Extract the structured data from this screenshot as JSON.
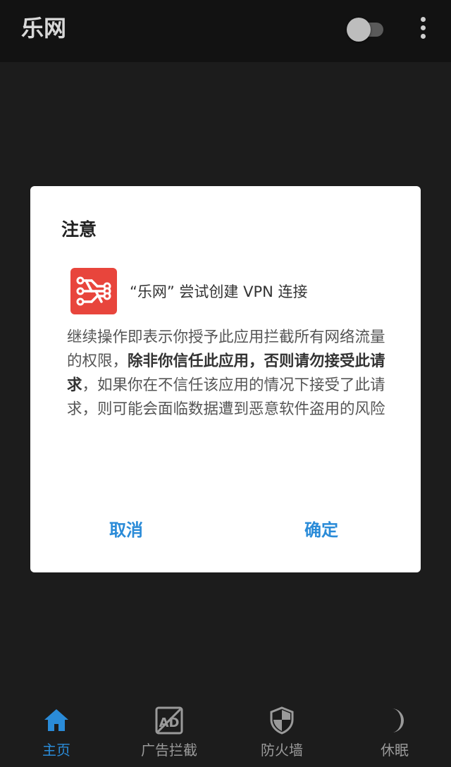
{
  "appbar": {
    "title": "乐网",
    "toggle_state": "off"
  },
  "dialog": {
    "title": "注意",
    "vpn_request": "“乐网” 尝试创建 VPN 连接",
    "body": {
      "part1": "继续操作即表示你授予此应用拦截所有网络流量的权限，",
      "part2_bold": "除非你信任此应用，否则请勿接受此请求",
      "part3": "，如果你在不信任该应用的情况下接受了此请求，则可能会面临数据遭到恶意软件盗用的风险"
    },
    "cancel_label": "取消",
    "ok_label": "确定"
  },
  "bottom_nav": {
    "items": [
      {
        "label": "主页",
        "icon": "home-icon",
        "active": true
      },
      {
        "label": "广告拦截",
        "icon": "ad-block-icon",
        "active": false
      },
      {
        "label": "防火墙",
        "icon": "shield-icon",
        "active": false
      },
      {
        "label": "休眠",
        "icon": "moon-icon",
        "active": false
      }
    ]
  },
  "colors": {
    "accent": "#2a8bd8",
    "app_icon": "#e8453c",
    "background": "#1c1c1c"
  }
}
